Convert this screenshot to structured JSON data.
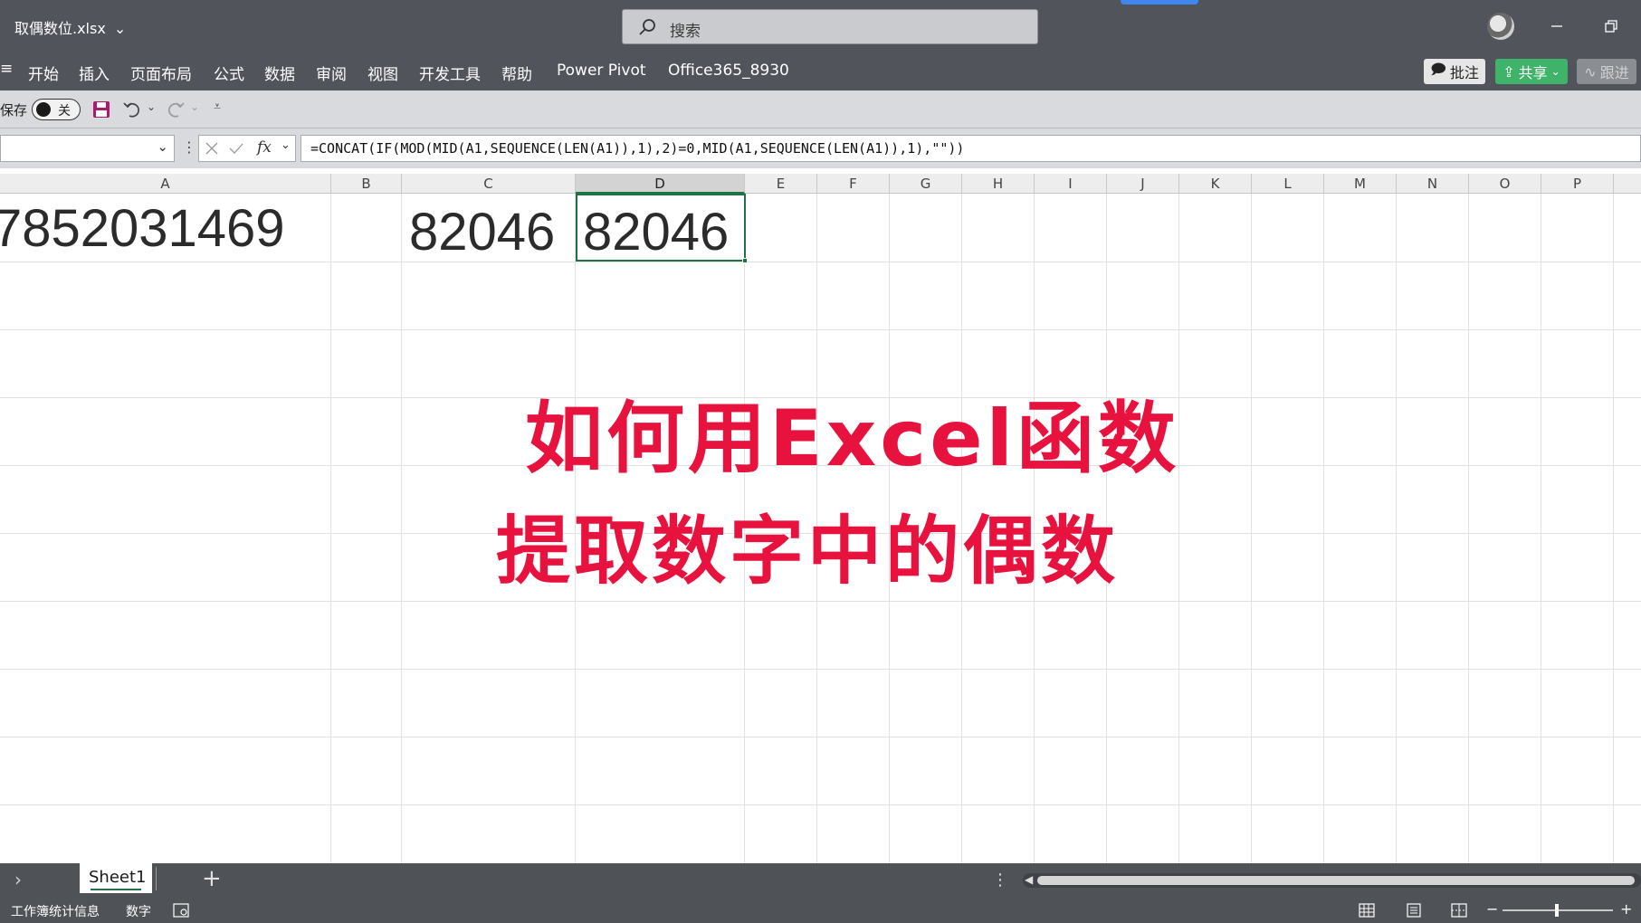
{
  "window": {
    "filename": "取偶数位.xlsx",
    "search_placeholder": "搜索"
  },
  "menu": {
    "items": [
      "开始",
      "插入",
      "页面布局",
      "公式",
      "数据",
      "审阅",
      "视图",
      "开发工具",
      "帮助",
      "Power Pivot",
      "Office365_8930"
    ],
    "comment_label": "批注",
    "share_label": "共享",
    "track_label": "跟进"
  },
  "quick_access": {
    "autosave_label": "保存",
    "autosave_state": "关"
  },
  "formula_bar": {
    "name_box": "",
    "formula": "=CONCAT(IF(MOD(MID(A1,SEQUENCE(LEN(A1)),1),2)=0,MID(A1,SEQUENCE(LEN(A1)),1),\"\"))"
  },
  "grid": {
    "columns": [
      "A",
      "B",
      "C",
      "D",
      "E",
      "F",
      "G",
      "H",
      "I",
      "J",
      "K",
      "L",
      "M",
      "N",
      "O",
      "P"
    ],
    "selected_column": "D",
    "cells": {
      "A1": "7852031469",
      "C1": "82046",
      "D1": "82046"
    }
  },
  "overlay": {
    "line1": "如何用Excel函数",
    "line2": "提取数字中的偶数"
  },
  "sheets": {
    "tabs": [
      "Sheet1"
    ],
    "add_label": "+"
  },
  "status": {
    "workbook_stats": "工作簿统计信息",
    "mode": "数字"
  },
  "colors": {
    "accent_green": "#217346",
    "overlay_red": "#e8123e",
    "titlebar_bg": "#51555b"
  }
}
